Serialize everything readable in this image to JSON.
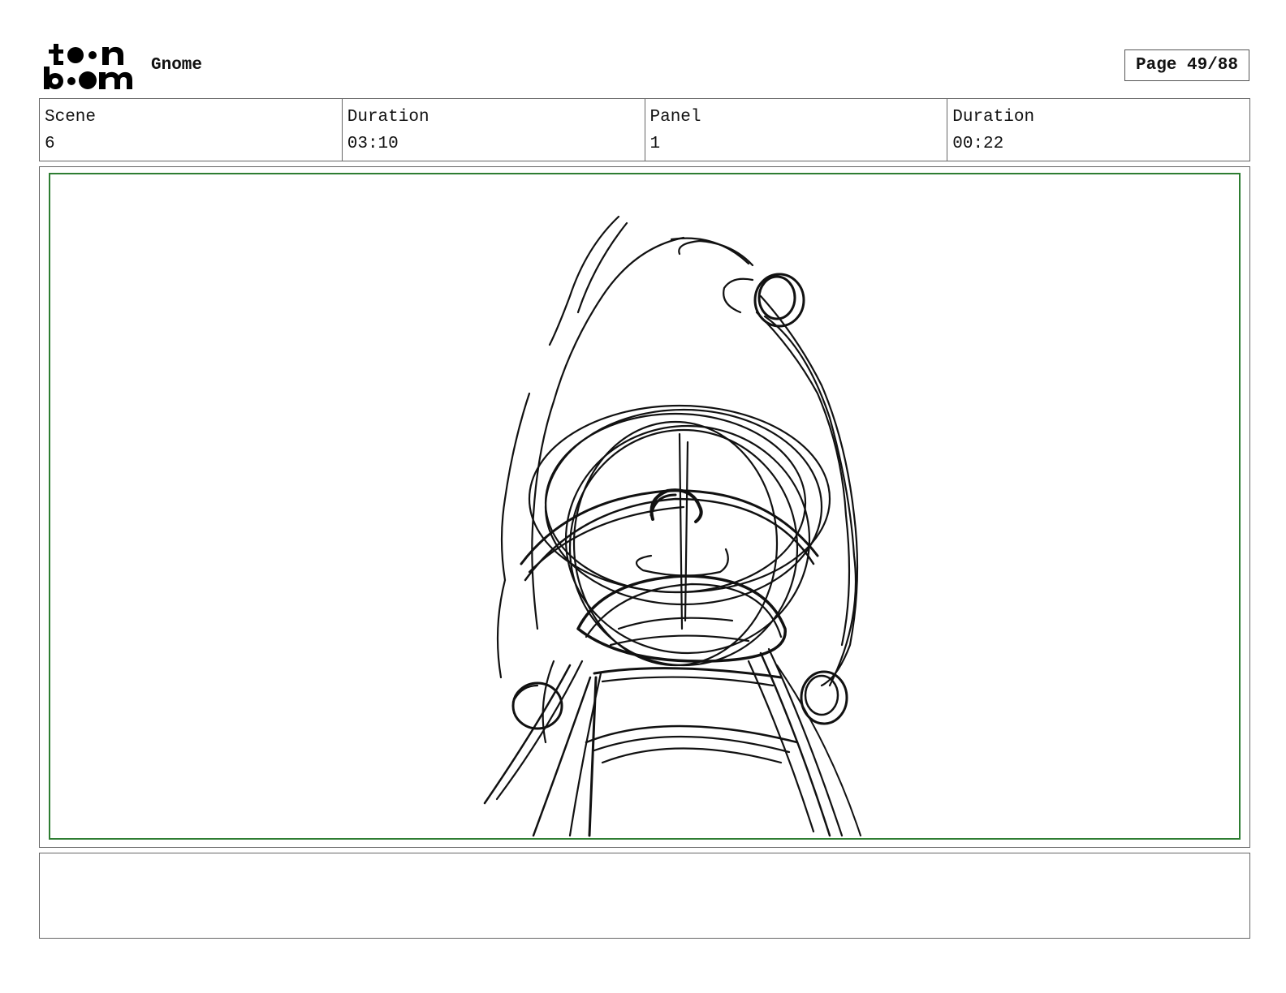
{
  "header": {
    "logo_text": "toon boom",
    "project_title": "Gnome",
    "page_label": "Page 49/88"
  },
  "info": [
    {
      "label": "Scene",
      "value": "6"
    },
    {
      "label": "Duration",
      "value": "03:10"
    },
    {
      "label": "Panel",
      "value": "1"
    },
    {
      "label": "Duration",
      "value": "00:22"
    }
  ],
  "panel": {
    "safe_frame_color": "#2e7d32",
    "sketch_subject": "gnome-rough-sketch"
  },
  "notes": {
    "text": ""
  }
}
